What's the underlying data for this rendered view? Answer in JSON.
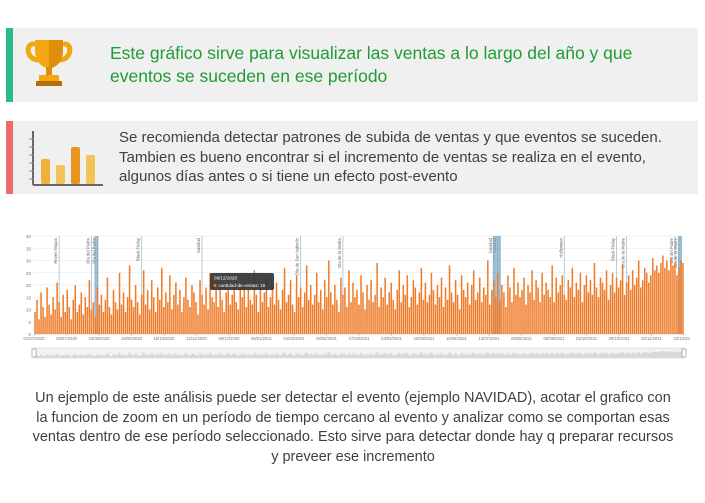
{
  "info_card": {
    "text": "Este gráfico sirve para visualizar las ventas a lo largo del año y que eventos se suceden en ese período",
    "icon": "trophy-icon",
    "accent_color": "#2bb98e",
    "text_color": "#1f9c32"
  },
  "tip_card": {
    "text": "Se recomienda detectar patrones de subida de ventas y que eventos se suceden. Tambien es bueno encontrar si el incremento de ventas se realiza en el evento, algunos días antes o si tiene un efecto post-evento",
    "icon": "bar-chart-icon",
    "accent_color": "#ee6b6b"
  },
  "chart_data": {
    "type": "bar",
    "series": [
      {
        "name": "cantidad-de-ventas",
        "color": "#f07c2a",
        "values": [
          9,
          14,
          6,
          17,
          11,
          7,
          19,
          12,
          8,
          15,
          10,
          21,
          13,
          7,
          16,
          9,
          18,
          11,
          6,
          14,
          20,
          9,
          12,
          17,
          8,
          15,
          11,
          22,
          10,
          13,
          7,
          19,
          12,
          16,
          9,
          14,
          23,
          11,
          8,
          18,
          13,
          10,
          25,
          12,
          17,
          9,
          15,
          28,
          14,
          11,
          20,
          13,
          8,
          16,
          26,
          12,
          18,
          10,
          22,
          15,
          9,
          19,
          14,
          27,
          11,
          17,
          13,
          24,
          10,
          16,
          21,
          12,
          18,
          9,
          15,
          23,
          14,
          11,
          20,
          17,
          13,
          8,
          22,
          16,
          12,
          19,
          10,
          25,
          15,
          13,
          18,
          11,
          21,
          14,
          9,
          17,
          24,
          12,
          16,
          20,
          13,
          10,
          19,
          15,
          22,
          11,
          18,
          14,
          12,
          26,
          16,
          9,
          20,
          13,
          17,
          23,
          11,
          15,
          19,
          12,
          21,
          14,
          10,
          18,
          27,
          13,
          16,
          22,
          12,
          9,
          24,
          15,
          19,
          11,
          17,
          28,
          14,
          20,
          12,
          16,
          25,
          13,
          18,
          10,
          22,
          15,
          30,
          17,
          12,
          20,
          14,
          9,
          23,
          16,
          19,
          11,
          26,
          13,
          21,
          15,
          18,
          12,
          24,
          17,
          10,
          20,
          14,
          22,
          13,
          16,
          29,
          11,
          19,
          15,
          23,
          12,
          17,
          21,
          14,
          10,
          18,
          26,
          13,
          20,
          16,
          24,
          11,
          15,
          22,
          19,
          12,
          17,
          27,
          14,
          21,
          13,
          16,
          25,
          18,
          12,
          20,
          15,
          23,
          11,
          19,
          14,
          28,
          17,
          13,
          22,
          16,
          10,
          24,
          18,
          15,
          21,
          12,
          20,
          26,
          14,
          17,
          23,
          13,
          19,
          16,
          30,
          12,
          18,
          22,
          15,
          25,
          14,
          20,
          17,
          11,
          24,
          19,
          13,
          27,
          16,
          21,
          15,
          18,
          23,
          12,
          20,
          17,
          26,
          14,
          22,
          19,
          13,
          25,
          16,
          21,
          18,
          15,
          28,
          13,
          23,
          17,
          20,
          24,
          16,
          14,
          22,
          19,
          27,
          15,
          21,
          18,
          25,
          13,
          20,
          24,
          17,
          22,
          16,
          29,
          19,
          15,
          23,
          21,
          18,
          26,
          14,
          20,
          25,
          17,
          23,
          19,
          22,
          28,
          16,
          21,
          24,
          18,
          26,
          20,
          23,
          30,
          19,
          22,
          27,
          25,
          21,
          24,
          31,
          26,
          28,
          25,
          29,
          32,
          27,
          30,
          26,
          31,
          28,
          29,
          24,
          27,
          30,
          29
        ]
      }
    ],
    "x_tick_labels": [
      "01/07/2020",
      "28/07/2020",
      "23/08/2020",
      "19/09/2020",
      "16/10/2020",
      "12/11/2020",
      "09/12/2020",
      "05/01/2021",
      "01/02/2021",
      "28/02/2021",
      "27/03/2021",
      "23/04/2021",
      "20/05/2021",
      "16/06/2021",
      "13/07/2021",
      "09/08/2021",
      "05/09/2021",
      "02/10/2021",
      "29/10/2021",
      "25/11/2021",
      "22/12/2021"
    ],
    "y_tick_labels": [
      "0",
      "5",
      "10",
      "15",
      "20",
      "25",
      "30",
      "35",
      "40"
    ],
    "ylim": [
      0,
      40
    ],
    "event_markers": [
      {
        "label": "Reyes Magos",
        "index": 12
      },
      {
        "label": "Día del Padre",
        "index": 28
      },
      {
        "label": "Día del Padre",
        "index": 31
      },
      {
        "label": "Black Friday",
        "index": 53
      },
      {
        "label": "Navidad",
        "index": 83
      },
      {
        "label": "Día de San Valentín",
        "index": 132
      },
      {
        "label": "Día de la Madre",
        "index": 153
      },
      {
        "label": "Navidad",
        "index": 228
      },
      {
        "label": "Navidad",
        "index": 230
      },
      {
        "label": "Halloween",
        "index": 263
      },
      {
        "label": "Black Friday",
        "index": 289
      },
      {
        "label": "Día de la Madre",
        "index": 294
      },
      {
        "label": "Día del Padre",
        "index": 318
      },
      {
        "label": "Día de la Madre",
        "index": 320
      },
      {
        "label": "Halloween",
        "index": 360
      }
    ],
    "highlighted_bars": [
      30,
      31,
      228,
      229,
      230,
      231,
      320,
      321
    ],
    "tooltip": {
      "date": "06/12/2020",
      "series_label": "cantidad-de-ventas: 16",
      "index": 85
    },
    "grid": true
  },
  "zoom_slider": {
    "label": "zoom-slider"
  },
  "note": {
    "text": "Un ejemplo de este análisis puede ser detectar el evento (ejemplo NAVIDAD), acotar el grafico con la funcion de zoom en un período de tiempo cercano al evento y analizar como se comportan esas ventas dentro de ese período seleccionado. Esto sirve para detectar donde hay q preparar recursos y preveer ese incremento"
  }
}
